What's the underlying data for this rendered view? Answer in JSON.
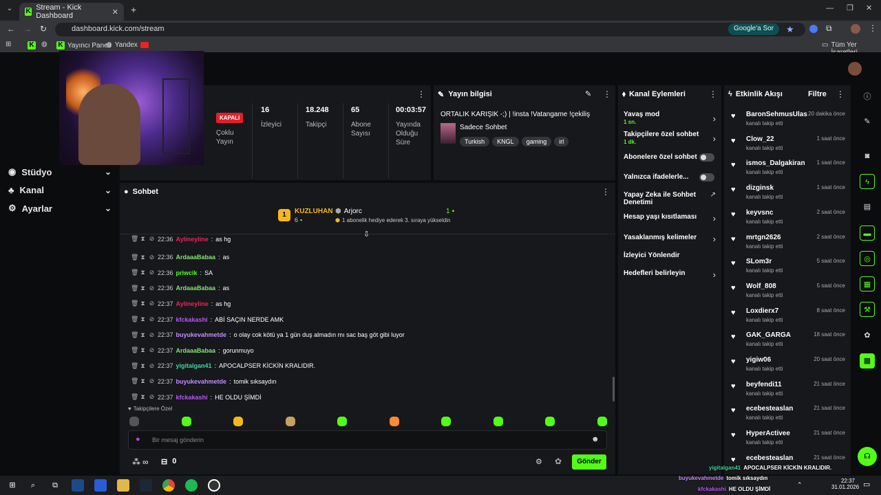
{
  "browser": {
    "tab_title": "Stream - Kick Dashboard",
    "url": "dashboard.kick.com/stream",
    "google_ask": "Google'a Sor",
    "bookmarks": [
      "Yayıncı Paneli",
      "Yandex"
    ],
    "all_bookmarks": "Tüm Yer İşaretleri"
  },
  "nav": [
    {
      "label": "Stüdyo",
      "icon": "studio-icon"
    },
    {
      "label": "Kanal",
      "icon": "channel-icon"
    },
    {
      "label": "Ayarlar",
      "icon": "gear-icon"
    }
  ],
  "stats": {
    "status": "KAPALI",
    "status_label": "Çoklu Yayın",
    "items": [
      {
        "value": "16",
        "label": "İzleyici"
      },
      {
        "value": "18.248",
        "label": "Takipçi"
      },
      {
        "value": "65",
        "label": "Abone Sayısı"
      },
      {
        "value": "00:03:57",
        "label": "Yayında Olduğu Süre"
      }
    ]
  },
  "stream_info": {
    "title": "Yayın bilgisi",
    "stream_title": "ORTALIK KARIŞIK -;) | !insta !Vatangame !çekiliş",
    "category": "Sadece Sohbet",
    "tags": [
      "Turkish",
      "KNGL",
      "gaming",
      "irl"
    ]
  },
  "chat": {
    "title": "Sohbet",
    "pinned_user": "KUZLUHAN",
    "pinned_badge": "1",
    "pinned_count": "6",
    "gift_user": "Arjorc",
    "gift_count": "1",
    "gift_text": "1 abonelik hediye ederek 3. sıraya yükseldin",
    "messages": [
      {
        "time": "22:36",
        "user": "Aylineyline",
        "text": "as hg",
        "color": "#e5255d"
      },
      {
        "time": "22:36",
        "user": "ArdaaaBabaa",
        "text": "as",
        "color": "#7ee56f"
      },
      {
        "time": "22:36",
        "user": "priwcik",
        "text": "SA",
        "color": "#53fc18"
      },
      {
        "time": "22:36",
        "user": "ArdaaaBabaa",
        "text": "as",
        "color": "#7ee56f"
      },
      {
        "time": "22:37",
        "user": "Aylineyline",
        "text": "as hg",
        "color": "#e5255d"
      },
      {
        "time": "22:37",
        "user": "kfckakashi",
        "text": "ABİ SAÇIN NERDE AMK",
        "color": "#b857f5"
      },
      {
        "time": "22:37",
        "user": "buyukevahmetde",
        "text": "o olay cok kötü ya 1 gün duş almadın mı sac baş göt gibi luyor",
        "color": "#c28cff"
      },
      {
        "time": "22:37",
        "user": "ArdaaaBabaa",
        "text": "gorunmuyo",
        "color": "#7ee56f"
      },
      {
        "time": "22:37",
        "user": "yigitalgan41",
        "text": "APOCALPSER KİCKİN KRALIDIR.",
        "color": "#3ad6a0"
      },
      {
        "time": "22:37",
        "user": "buyukevahmetde",
        "text": "tomik sıksaydın",
        "color": "#c28cff"
      },
      {
        "time": "22:37",
        "user": "kfckakashi",
        "text": "HE OLDU ŞİMDİ",
        "color": "#b857f5"
      }
    ],
    "emote_section": "Takipçilere Özel",
    "input_placeholder": "Bir mesaj gönderin",
    "infinity": "∞",
    "points": "0",
    "send": "Gönder"
  },
  "actions": {
    "title": "Kanal Eylemleri",
    "items": [
      {
        "label": "Yavaş mod",
        "sub": "1 sn.",
        "type": "arrow"
      },
      {
        "label": "Takipçilere özel sohbet",
        "sub": "1 dk.",
        "type": "arrow"
      },
      {
        "label": "Abonelere özel sohbet",
        "sub": "",
        "type": "toggle"
      },
      {
        "label": "Yalnızca ifadelerle...",
        "sub": "",
        "type": "toggle"
      },
      {
        "label": "Yapay Zeka ile Sohbet Denetimi",
        "sub": "",
        "type": "link"
      },
      {
        "label": "Hesap yaşı kısıtlaması",
        "sub": "",
        "type": "arrow"
      },
      {
        "label": "Yasaklanmış kelimeler",
        "sub": "",
        "type": "arrow"
      },
      {
        "label": "İzleyici Yönlendir",
        "sub": "",
        "type": "none"
      },
      {
        "label": "Hedefleri belirleyin",
        "sub": "",
        "type": "arrow"
      }
    ]
  },
  "activity": {
    "title": "Etkinlik Akışı",
    "filter": "Filtre",
    "events": [
      {
        "user": "BaronSehmusUlas",
        "action": "kanalı takip etti",
        "time": "20 dakika önce"
      },
      {
        "user": "Clow_22",
        "action": "kanalı takip etti",
        "time": "1 saat önce"
      },
      {
        "user": "ismos_Dalgakiran",
        "action": "kanalı takip etti",
        "time": "1 saat önce"
      },
      {
        "user": "dizginsk",
        "action": "kanalı takip etti",
        "time": "1 saat önce"
      },
      {
        "user": "keyvsnc",
        "action": "kanalı takip etti",
        "time": "2 saat önce"
      },
      {
        "user": "mrtgn2626",
        "action": "kanalı takip etti",
        "time": "2 saat önce"
      },
      {
        "user": "SLom3r",
        "action": "kanalı takip etti",
        "time": "5 saat önce"
      },
      {
        "user": "Wolf_808",
        "action": "kanalı takip etti",
        "time": "5 saat önce"
      },
      {
        "user": "Loxdierx7",
        "action": "kanalı takip etti",
        "time": "8 saat önce"
      },
      {
        "user": "GAK_GARGA",
        "action": "kanalı takip etti",
        "time": "18 saat önce"
      },
      {
        "user": "yigiw06",
        "action": "kanalı takip etti",
        "time": "20 saat önce"
      },
      {
        "user": "beyfendi11",
        "action": "kanalı takip etti",
        "time": "21 saat önce"
      },
      {
        "user": "ecebesteaslan",
        "action": "kanalı takip etti",
        "time": "21 saat önce"
      },
      {
        "user": "HyperActivee",
        "action": "kanalı takip etti",
        "time": "21 saat önce"
      },
      {
        "user": "ecebesteaslan",
        "action": "",
        "time": "21 saat önce"
      }
    ]
  },
  "overlay": [
    {
      "user": "yigitalgan41",
      "text": "APOCALPSER KİCKİN KRALIDIR."
    },
    {
      "user": "buyukevahmetde",
      "text": "tomik sıksaydın"
    },
    {
      "user": "kfckakashi",
      "text": "HE OLDU ŞİMDİ"
    }
  ],
  "taskbar": {
    "time": "22:37",
    "date": "31.01.2026"
  },
  "colors": {
    "accent": "#53fc18",
    "panel": "#17181b",
    "bg": "#0b0c0e"
  }
}
